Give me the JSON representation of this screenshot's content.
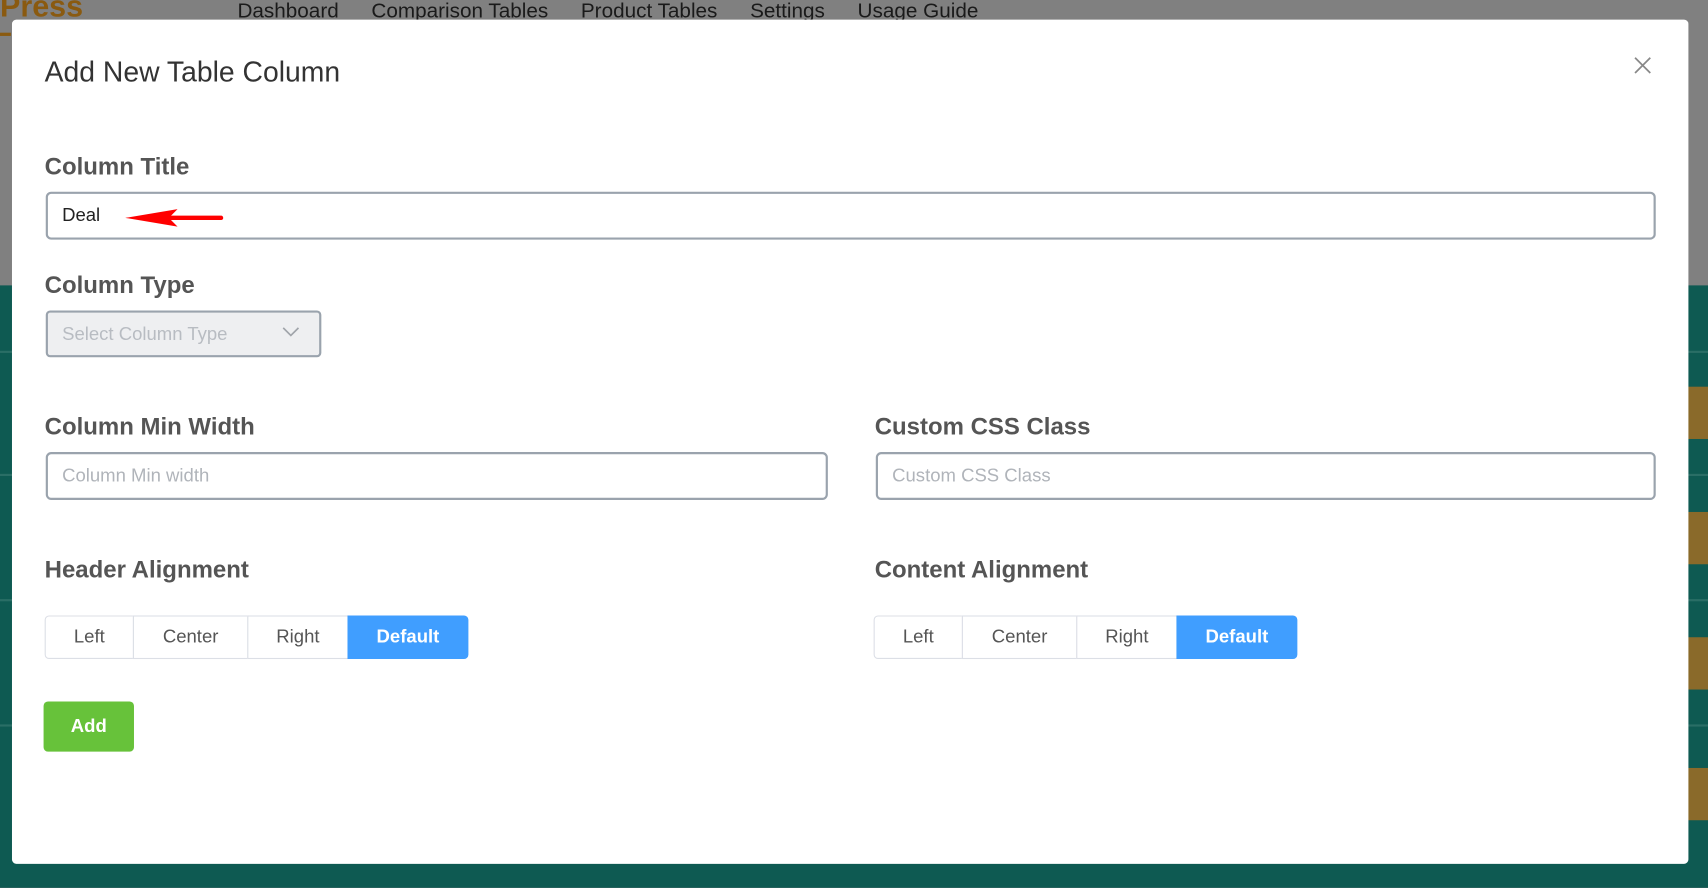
{
  "app": {
    "logo_text": "Press",
    "nav": [
      "Dashboard",
      "Comparison Tables",
      "Product Tables",
      "Settings",
      "Usage Guide"
    ]
  },
  "modal": {
    "title": "Add New Table Column",
    "column_title": {
      "label": "Column Title",
      "value": "Deal"
    },
    "column_type": {
      "label": "Column Type",
      "placeholder": "Select Column Type"
    },
    "min_width": {
      "label": "Column Min Width",
      "placeholder": "Column Min width"
    },
    "css_class": {
      "label": "Custom CSS Class",
      "placeholder": "Custom CSS Class"
    },
    "header_alignment": {
      "label": "Header Alignment",
      "options": [
        "Left",
        "Center",
        "Right",
        "Default"
      ],
      "selected": "Default"
    },
    "content_alignment": {
      "label": "Content Alignment",
      "options": [
        "Left",
        "Center",
        "Right",
        "Default"
      ],
      "selected": "Default"
    },
    "add_label": "Add"
  },
  "colors": {
    "primary": "#409eff",
    "success": "#67c23a",
    "annotation_arrow": "#ff0000"
  },
  "icons": {
    "close": "close-icon",
    "select": "chevron-down-icon",
    "annotation": "arrow-left-icon"
  }
}
